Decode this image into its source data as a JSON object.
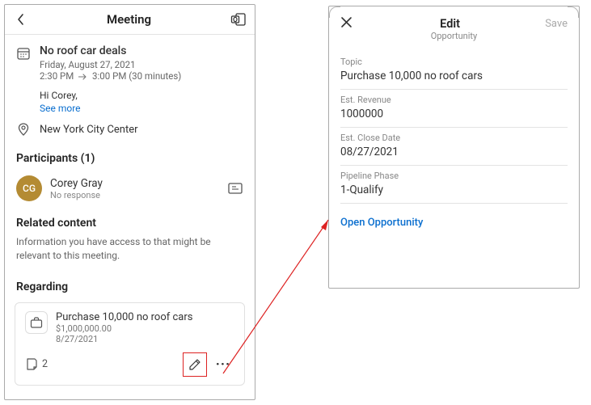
{
  "left": {
    "header_title": "Meeting",
    "subject": "No roof car deals",
    "date": "Friday, August 27, 2021",
    "time_start": "2:30 PM",
    "time_end": "3:00 PM (30 minutes)",
    "greeting": "Hi Corey,",
    "see_more": "See more",
    "location": "New York City Center",
    "participants_heading": "Participants (1)",
    "participant": {
      "initials": "CG",
      "name": "Corey Gray",
      "response": "No response"
    },
    "related_heading": "Related content",
    "related_desc": "Information you have access to that might be relevant to this meeting.",
    "regarding_heading": "Regarding",
    "regarding": {
      "title": "Purchase 10,000 no roof cars",
      "revenue": "$1,000,000.00",
      "date": "8/27/2021",
      "note_count": "2"
    }
  },
  "right": {
    "header_title": "Edit",
    "header_sub": "Opportunity",
    "save": "Save",
    "fields": {
      "topic_label": "Topic",
      "topic_value": "Purchase 10,000 no roof cars",
      "rev_label": "Est. Revenue",
      "rev_value": "1000000",
      "close_label": "Est. Close Date",
      "close_value": "08/27/2021",
      "phase_label": "Pipeline Phase",
      "phase_value": "1-Qualify"
    },
    "open_link": "Open Opportunity"
  }
}
